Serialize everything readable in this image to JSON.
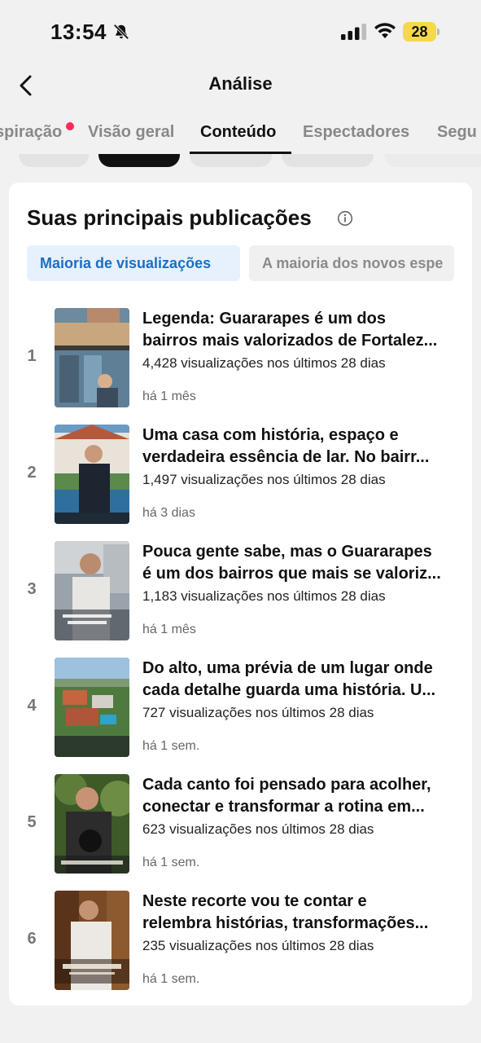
{
  "status_bar": {
    "time": "13:54",
    "battery": "28",
    "icons": [
      "bell-slash-icon",
      "signal-icon",
      "wifi-icon",
      "battery-icon"
    ]
  },
  "header": {
    "title": "Análise",
    "back_icon": "chevron-left-icon"
  },
  "tabs": [
    {
      "label": "spiração",
      "has_dot": true
    },
    {
      "label": "Visão geral"
    },
    {
      "label": "Conteúdo",
      "active": true
    },
    {
      "label": "Espectadores"
    },
    {
      "label": "Segu"
    }
  ],
  "colors": {
    "accent_blue": "#1a6fc4",
    "notification_dot": "#fe2c55",
    "battery": "#f5d94a"
  },
  "section": {
    "title": "Suas principais publicações",
    "info_icon": "info-circle-icon",
    "segments": [
      {
        "label": "Maioria de visualizações",
        "active": true
      },
      {
        "label": "A maioria dos novos espe",
        "active": false
      }
    ]
  },
  "posts": [
    {
      "rank": "1",
      "line1": "Legenda: Guararapes é um dos",
      "line2": "bairros mais valorizados de Fortalez...",
      "views": "4,428 visualizações nos últimos 28 dias",
      "date": "há 1 mês"
    },
    {
      "rank": "2",
      "line1": "Uma casa com história, espaço e",
      "line2": "verdadeira essência de lar. No bairr...",
      "views": "1,497 visualizações nos últimos 28 dias",
      "date": "há 3 dias"
    },
    {
      "rank": "3",
      "line1": "Pouca gente sabe, mas o Guararapes",
      "line2": "é um dos bairros que mais se valoriz...",
      "views": "1,183 visualizações nos últimos 28 dias",
      "date": "há 1 mês"
    },
    {
      "rank": "4",
      "line1": "Do alto, uma prévia de um lugar onde",
      "line2": "cada detalhe guarda uma história. U...",
      "views": "727 visualizações nos últimos 28 dias",
      "date": "há 1 sem."
    },
    {
      "rank": "5",
      "line1": "Cada canto foi pensado para acolher,",
      "line2": "conectar e transformar a rotina em...",
      "views": "623 visualizações nos últimos 28 dias",
      "date": "há 1 sem."
    },
    {
      "rank": "6",
      "line1": "Neste recorte vou te contar e",
      "line2": "relembra histórias, transformações...",
      "views": "235 visualizações nos últimos 28 dias",
      "date": "há 1 sem."
    }
  ]
}
